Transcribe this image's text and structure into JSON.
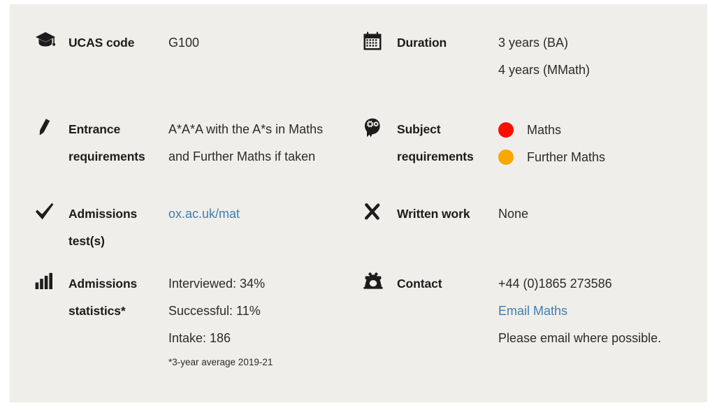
{
  "panel": {
    "background": "#f0eeea",
    "link_color": "#3f7eb0",
    "text_color": "#2b2b2b",
    "label_color": "#1c1c1c"
  },
  "facts": {
    "ucas_code": {
      "icon": "graduation-cap-icon",
      "label": "UCAS code",
      "value": "G100"
    },
    "duration": {
      "icon": "calendar-icon",
      "label": "Duration",
      "lines": [
        "3 years (BA)",
        "4 years (MMath)"
      ]
    },
    "entrance_requirements": {
      "icon": "pencil-icon",
      "label_line1": "Entrance",
      "label_line2": "requirements",
      "lines": [
        "A*A*A with the A*s in Maths",
        "and Further Maths if taken"
      ]
    },
    "subject_requirements": {
      "icon": "head-gear-icon",
      "label_line1": "Subject",
      "label_line2": "requirements",
      "items": [
        {
          "label": "Maths",
          "color": "#fd0d02"
        },
        {
          "label": "Further Maths",
          "color": "#f9a800"
        }
      ]
    },
    "admissions_test": {
      "icon": "check-icon",
      "label_line1": "Admissions",
      "label_line2": "test(s)",
      "link_text": "ox.ac.uk/mat"
    },
    "written_work": {
      "icon": "cross-icon",
      "label": "Written work",
      "value": "None"
    },
    "admissions_statistics": {
      "icon": "bar-chart-icon",
      "label_line1": "Admissions",
      "label_line2": "statistics*",
      "lines": [
        "Interviewed: 34%",
        "Successful: 11%",
        "Intake: 186"
      ],
      "footnote": "*3-year average 2019-21"
    },
    "contact": {
      "icon": "telephone-icon",
      "label": "Contact",
      "phone": "+44 (0)1865 273586",
      "email_link_text": "Email Maths",
      "note": "Please email where possible."
    }
  }
}
